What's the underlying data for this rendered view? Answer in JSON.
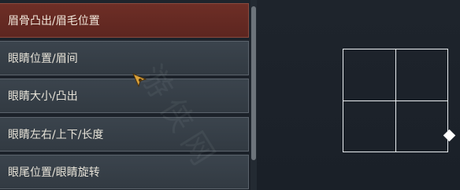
{
  "menu": {
    "items": [
      {
        "label": "眉骨凸出/眉毛位置",
        "active": true
      },
      {
        "label": "眼睛位置/眉间",
        "active": false
      },
      {
        "label": "眼睛大小/凸出",
        "active": false
      },
      {
        "label": "眼睛左右/上下/长度",
        "active": false
      },
      {
        "label": "眼尾位置/眼睛旋转",
        "active": false
      }
    ]
  },
  "watermark": {
    "text": "游侠网"
  },
  "cursor": {
    "icon": "pointer-cursor-icon"
  },
  "adjust_pad": {
    "icon": "diamond-handle-icon"
  },
  "colors": {
    "active_item": "#6e2e26",
    "item": "#38414a",
    "background": "#1c222a",
    "grid_line": "#e8ecef"
  }
}
